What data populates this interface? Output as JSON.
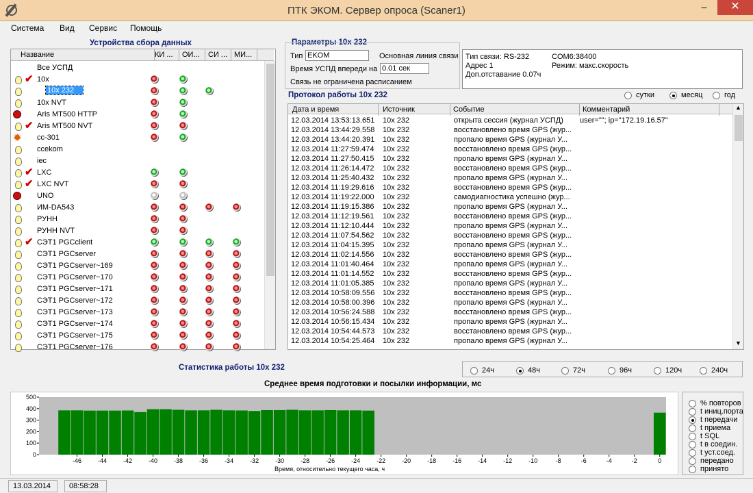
{
  "window": {
    "title": "ПТК ЭКОМ. Сервер опроса (Scaner1)",
    "min": "–",
    "max": "□",
    "close": "✕"
  },
  "menu": [
    "Система",
    "Вид",
    "Сервис",
    "Помощь"
  ],
  "devices": {
    "title": "Устройства сбора данных",
    "columns": [
      "Название",
      "КИ ...",
      "ОИ...",
      "СИ ...",
      "МИ..."
    ],
    "rows": [
      {
        "name": "Все УСПД",
        "icon": "",
        "check": false,
        "dots": [
          "",
          "",
          "",
          ""
        ]
      },
      {
        "name": "10x",
        "icon": "bulb",
        "check": true,
        "dots": [
          "r",
          "g",
          "",
          ""
        ]
      },
      {
        "name": "10x 232",
        "icon": "bulb",
        "check": false,
        "selected": true,
        "dots": [
          "r",
          "g",
          "g",
          ""
        ]
      },
      {
        "name": "10x NVT",
        "icon": "bulb",
        "check": false,
        "dots": [
          "r",
          "g",
          "",
          ""
        ]
      },
      {
        "name": "Aris MT500 HTTP",
        "icon": "red",
        "check": false,
        "dots": [
          "r",
          "g",
          "",
          ""
        ]
      },
      {
        "name": "Aris MT500 NVT",
        "icon": "bulb",
        "check": true,
        "dots": [
          "r",
          "r",
          "",
          ""
        ]
      },
      {
        "name": "cc-301",
        "icon": "star",
        "check": false,
        "dots": [
          "r",
          "g",
          "",
          ""
        ]
      },
      {
        "name": "ccekom",
        "icon": "bulb",
        "check": false,
        "dots": [
          "",
          "",
          "",
          ""
        ]
      },
      {
        "name": "iec",
        "icon": "bulb",
        "check": false,
        "dots": [
          "",
          "",
          "",
          ""
        ]
      },
      {
        "name": "LXC",
        "icon": "bulb",
        "check": true,
        "dots": [
          "g",
          "g",
          "",
          ""
        ]
      },
      {
        "name": "LXC NVT",
        "icon": "bulb",
        "check": true,
        "dots": [
          "r",
          "r",
          "",
          ""
        ]
      },
      {
        "name": "UNO",
        "icon": "red",
        "check": false,
        "dots": [
          "w",
          "w",
          "",
          ""
        ]
      },
      {
        "name": "ИМ-DA543",
        "icon": "bulb",
        "check": false,
        "dots": [
          "r",
          "r",
          "r",
          "r"
        ]
      },
      {
        "name": "РУНН",
        "icon": "bulb",
        "check": false,
        "dots": [
          "r",
          "r",
          "",
          ""
        ]
      },
      {
        "name": "РУНН NVT",
        "icon": "bulb",
        "check": false,
        "dots": [
          "r",
          "r",
          "",
          ""
        ]
      },
      {
        "name": "СЭТ1 PGCclient",
        "icon": "bulb",
        "check": true,
        "dots": [
          "g",
          "g",
          "g",
          "g"
        ]
      },
      {
        "name": "СЭТ1 PGCserver",
        "icon": "bulb",
        "check": false,
        "dots": [
          "r",
          "r",
          "r",
          "r"
        ]
      },
      {
        "name": "СЭТ1 PGCserver~169",
        "icon": "bulb",
        "check": false,
        "dots": [
          "r",
          "r",
          "r",
          "r"
        ]
      },
      {
        "name": "СЭТ1 PGCserver~170",
        "icon": "bulb",
        "check": false,
        "dots": [
          "r",
          "r",
          "r",
          "r"
        ]
      },
      {
        "name": "СЭТ1 PGCserver~171",
        "icon": "bulb",
        "check": false,
        "dots": [
          "r",
          "r",
          "r",
          "r"
        ]
      },
      {
        "name": "СЭТ1 PGCserver~172",
        "icon": "bulb",
        "check": false,
        "dots": [
          "r",
          "r",
          "r",
          "r"
        ]
      },
      {
        "name": "СЭТ1 PGCserver~173",
        "icon": "bulb",
        "check": false,
        "dots": [
          "r",
          "r",
          "r",
          "r"
        ]
      },
      {
        "name": "СЭТ1 PGCserver~174",
        "icon": "bulb",
        "check": false,
        "dots": [
          "r",
          "r",
          "r",
          "r"
        ]
      },
      {
        "name": "СЭТ1 PGCserver~175",
        "icon": "bulb",
        "check": false,
        "dots": [
          "r",
          "r",
          "r",
          "r"
        ]
      },
      {
        "name": "СЭТ1 PGCserver~176",
        "icon": "bulb",
        "check": false,
        "dots": [
          "r",
          "r",
          "r",
          "r"
        ]
      }
    ]
  },
  "params": {
    "title": "Параметры 10x 232",
    "type_label": "Тип",
    "type_value": "EKOM",
    "main_line": "Основная линия связи",
    "time_label": "Время УСПД впереди на",
    "time_value": "0.01 сек",
    "schedule": "Связь не ограничена расписанием",
    "info": [
      "Тип связи: RS-232",
      "COM6:38400",
      "Адрес 1",
      "Режим: макс.скорость",
      "Доп.отставание 0.07ч"
    ]
  },
  "protocol": {
    "title": "Протокол работы 10x 232",
    "periods": [
      "сутки",
      "месяц",
      "год"
    ],
    "period_selected": 1,
    "columns": [
      "Дата и время",
      "Источник",
      "Событие",
      "Комментарий"
    ],
    "rows": [
      [
        "12.03.2014 13:53:13.651",
        "10x 232",
        "открыта сессия (журнал УСПД)",
        "user=\"\"; ip=\"172.19.16.57\""
      ],
      [
        "12.03.2014 13:44:29.558",
        "10x 232",
        "восстановлено время GPS (жур...",
        ""
      ],
      [
        "12.03.2014 13:44:20.391",
        "10x 232",
        "пропало время GPS (журнал У...",
        ""
      ],
      [
        "12.03.2014 11:27:59.474",
        "10x 232",
        "восстановлено время GPS (жур...",
        ""
      ],
      [
        "12.03.2014 11:27:50.415",
        "10x 232",
        "пропало время GPS (журнал У...",
        ""
      ],
      [
        "12.03.2014 11:26:14.472",
        "10x 232",
        "восстановлено время GPS (жур...",
        ""
      ],
      [
        "12.03.2014 11:25:40.432",
        "10x 232",
        "пропало время GPS (журнал У...",
        ""
      ],
      [
        "12.03.2014 11:19:29.616",
        "10x 232",
        "восстановлено время GPS (жур...",
        ""
      ],
      [
        "12.03.2014 11:19:22.000",
        "10x 232",
        "самодиагностика успешно (жур...",
        ""
      ],
      [
        "12.03.2014 11:19:15.386",
        "10x 232",
        "пропало время GPS (журнал У...",
        ""
      ],
      [
        "12.03.2014 11:12:19.561",
        "10x 232",
        "восстановлено время GPS (жур...",
        ""
      ],
      [
        "12.03.2014 11:12:10.444",
        "10x 232",
        "пропало время GPS (журнал У...",
        ""
      ],
      [
        "12.03.2014 11:07:54.562",
        "10x 232",
        "восстановлено время GPS (жур...",
        ""
      ],
      [
        "12.03.2014 11:04:15.395",
        "10x 232",
        "пропало время GPS (журнал У...",
        ""
      ],
      [
        "12.03.2014 11:02:14.556",
        "10x 232",
        "восстановлено время GPS (жур...",
        ""
      ],
      [
        "12.03.2014 11:01:40.464",
        "10x 232",
        "пропало время GPS (журнал У...",
        ""
      ],
      [
        "12.03.2014 11:01:14.552",
        "10x 232",
        "восстановлено время GPS (жур...",
        ""
      ],
      [
        "12.03.2014 11:01:05.385",
        "10x 232",
        "пропало время GPS (журнал У...",
        ""
      ],
      [
        "12.03.2014 10:58:09.556",
        "10x 232",
        "восстановлено время GPS (жур...",
        ""
      ],
      [
        "12.03.2014 10:58:00.396",
        "10x 232",
        "пропало время GPS (журнал У...",
        ""
      ],
      [
        "12.03.2014 10:56:24.588",
        "10x 232",
        "восстановлено время GPS (жур...",
        ""
      ],
      [
        "12.03.2014 10:56:15.434",
        "10x 232",
        "пропало время GPS (журнал У...",
        ""
      ],
      [
        "12.03.2014 10:54:44.573",
        "10x 232",
        "восстановлено время GPS (жур...",
        ""
      ],
      [
        "12.03.2014 10:54:25.464",
        "10x 232",
        "пропало время GPS (журнал У...",
        ""
      ]
    ]
  },
  "stats": {
    "title": "Статистика работы 10x 232",
    "ranges": [
      "24ч",
      "48ч",
      "72ч",
      "96ч",
      "120ч",
      "240ч"
    ],
    "range_selected": 1,
    "metrics": [
      "% повторов",
      "t иниц.порта",
      "t передачи",
      "t приема",
      "t SQL",
      "t в соедин.",
      "t уст.соед.",
      "передано",
      "принято"
    ],
    "metric_selected": 2
  },
  "chart_data": {
    "type": "bar",
    "title": "Среднее время подготовки и посылки информации, мс",
    "xlabel": "Время, относительно текущего часа,  ч",
    "ylabel": "",
    "xlim": [
      -48,
      0
    ],
    "ylim": [
      0,
      500
    ],
    "yticks": [
      0,
      100,
      200,
      300,
      400,
      500
    ],
    "xticks": [
      -46,
      -44,
      -42,
      -40,
      -38,
      -36,
      -34,
      -32,
      -30,
      -28,
      -26,
      -24,
      -22,
      -20,
      -18,
      -16,
      -14,
      -12,
      -10,
      -8,
      -6,
      -4,
      -2,
      0
    ],
    "x": [
      -47,
      -46,
      -45,
      -44,
      -43,
      -42,
      -41,
      -40,
      -39,
      -38,
      -37,
      -36,
      -35,
      -34,
      -33,
      -32,
      -31,
      -30,
      -29,
      -28,
      -27,
      -26,
      -25,
      -24,
      -23,
      0
    ],
    "values": [
      385,
      385,
      383,
      383,
      383,
      384,
      370,
      395,
      395,
      390,
      385,
      385,
      390,
      385,
      384,
      380,
      387,
      387,
      390,
      385,
      385,
      387,
      385,
      385,
      383,
      365
    ],
    "bar_color": "#008000",
    "background": "#bfbfbf",
    "grid": false
  },
  "status": {
    "date": "13.03.2014",
    "time": "08:58:28"
  }
}
